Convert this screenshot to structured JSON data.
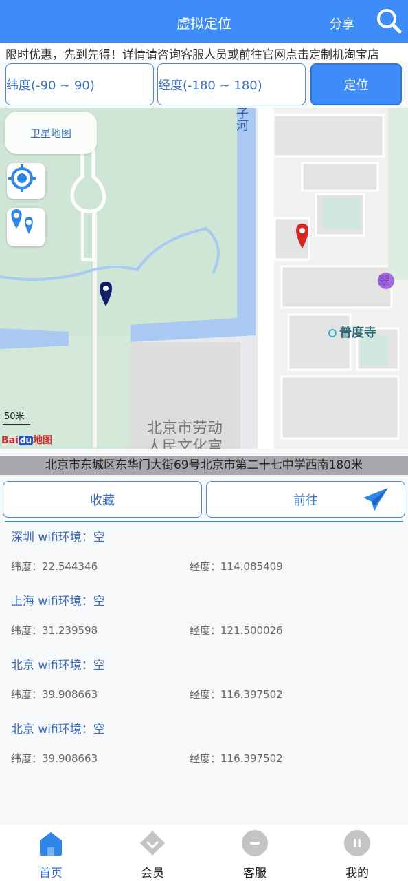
{
  "header": {
    "title": "虚拟定位",
    "share_label": "分享",
    "search_icon": "search-icon"
  },
  "marquee": {
    "text": "限时优惠，先到先得！详情请咨询客服人员或前往官网点击定制机淘宝店"
  },
  "inputs": {
    "latitude_placeholder": "纬度(-90 ~ 90)",
    "longitude_placeholder": "经度(-180 ~ 180)",
    "locate_label": "定位"
  },
  "map": {
    "satellite_label": "卫星地图",
    "scale_label": "50米",
    "brand_text": "Bai",
    "brand_badge": "du",
    "brand_suffix": "地图",
    "labels": {
      "river": "子河",
      "temple": "普度寺",
      "palace_line1": "北京市劳动",
      "palace_line2": "人民文化宫",
      "hotel_char": "翠"
    }
  },
  "address": "北京市东城区东华门大街69号北京市第二十七中学西南180米",
  "actions": {
    "favorite_label": "收藏",
    "go_label": "前往"
  },
  "locations": [
    {
      "name": "深圳 wifi环境：空",
      "lat": "纬度：22.544346",
      "lng": "经度：114.085409"
    },
    {
      "name": "上海 wifi环境：空",
      "lat": "纬度：31.239598",
      "lng": "经度：121.500026"
    },
    {
      "name": "北京 wifi环境：空",
      "lat": "纬度：39.908663",
      "lng": "经度：116.397502"
    },
    {
      "name": "北京 wifi环境：空",
      "lat": "纬度：39.908663",
      "lng": "经度：116.397502"
    }
  ],
  "nav": [
    {
      "label": "首页",
      "icon": "home-icon",
      "active": true
    },
    {
      "label": "会员",
      "icon": "vip-diamond-icon",
      "active": false
    },
    {
      "label": "客服",
      "icon": "service-icon",
      "active": false
    },
    {
      "label": "我的",
      "icon": "profile-icon",
      "active": false
    }
  ],
  "colors": {
    "accent": "#3d8cf8",
    "text_link": "#3a6fc0",
    "pin_red": "#d6281e",
    "pin_navy": "#14206b"
  }
}
